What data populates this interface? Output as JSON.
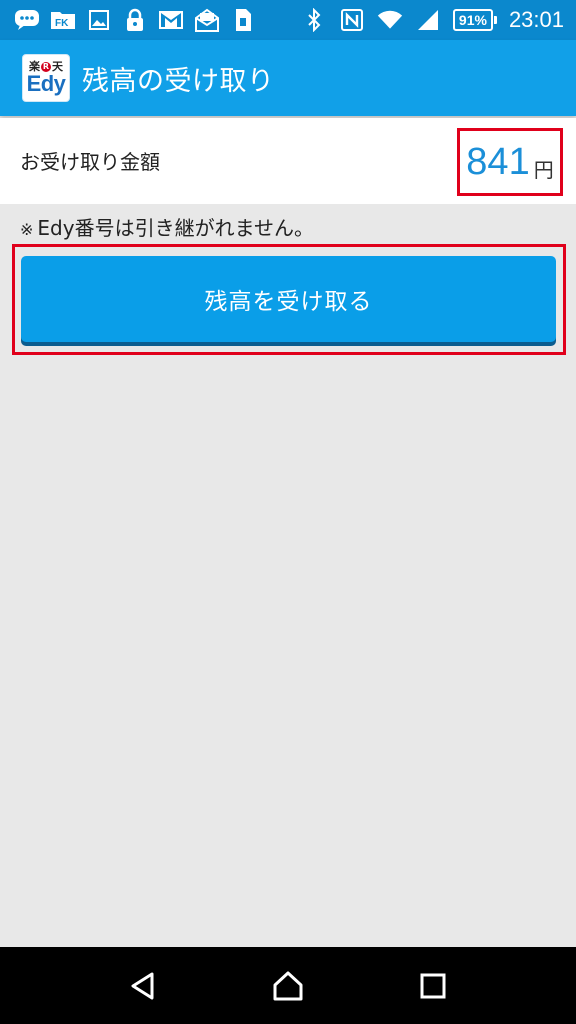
{
  "status_bar": {
    "icons": [
      "chat-bubble-icon",
      "fk-folder-icon",
      "image-icon",
      "lock-icon",
      "gmail-icon",
      "email-icon",
      "sim-card-icon",
      "bluetooth-icon",
      "nfc-icon",
      "wifi-icon",
      "signal-icon"
    ],
    "battery_percent": "91%",
    "time": "23:01"
  },
  "app_bar": {
    "logo": {
      "line1": "楽",
      "line1_b": "天",
      "line2": "Edy",
      "r_mark": "R"
    },
    "title": "残高の受け取り"
  },
  "amount": {
    "label": "お受け取り金額",
    "value": "841",
    "unit": "円"
  },
  "note": {
    "mark": "※",
    "text": "Edy番号は引き継がれません。"
  },
  "receive_button": {
    "label": "残高を受け取る"
  },
  "nav_bar": {
    "buttons": [
      "back-icon",
      "home-icon",
      "recents-icon"
    ]
  },
  "colors": {
    "status_bar": "#0b88cd",
    "app_bar": "#11a0e8",
    "button": "#0a9ee8",
    "amount_text": "#1b8fd8",
    "highlight_frame": "#e0001b",
    "background": "#e8e8e8"
  }
}
